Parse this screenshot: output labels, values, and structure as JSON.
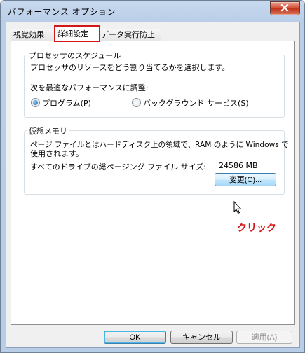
{
  "window": {
    "title": "パフォーマンス オプション"
  },
  "tabs": [
    {
      "label": "視覚効果"
    },
    {
      "label": "詳細設定"
    },
    {
      "label": "データ実行防止"
    }
  ],
  "processor": {
    "title": "プロセッサのスケジュール",
    "description": "プロセッサのリソースをどう割り当てるかを選択します。",
    "adjust_label": "次を最適なパフォーマンスに調整:",
    "option_programs": "プログラム(P)",
    "option_background": "バックグラウンド サービス(S)"
  },
  "virtual_memory": {
    "title": "仮想メモリ",
    "description_line1": "ページ ファイルとはハードディスク上の領域で、RAM のように Windows で",
    "description_line2": "使用されます。",
    "total_label": "すべてのドライブの総ページング ファイル サイズ:",
    "total_value": "24586 MB",
    "change_button": "変更(C)..."
  },
  "annotation": {
    "click_text": "クリック",
    "color": "#d11717"
  },
  "footer": {
    "ok": "OK",
    "cancel": "キャンセル",
    "apply": "適用(A)"
  }
}
